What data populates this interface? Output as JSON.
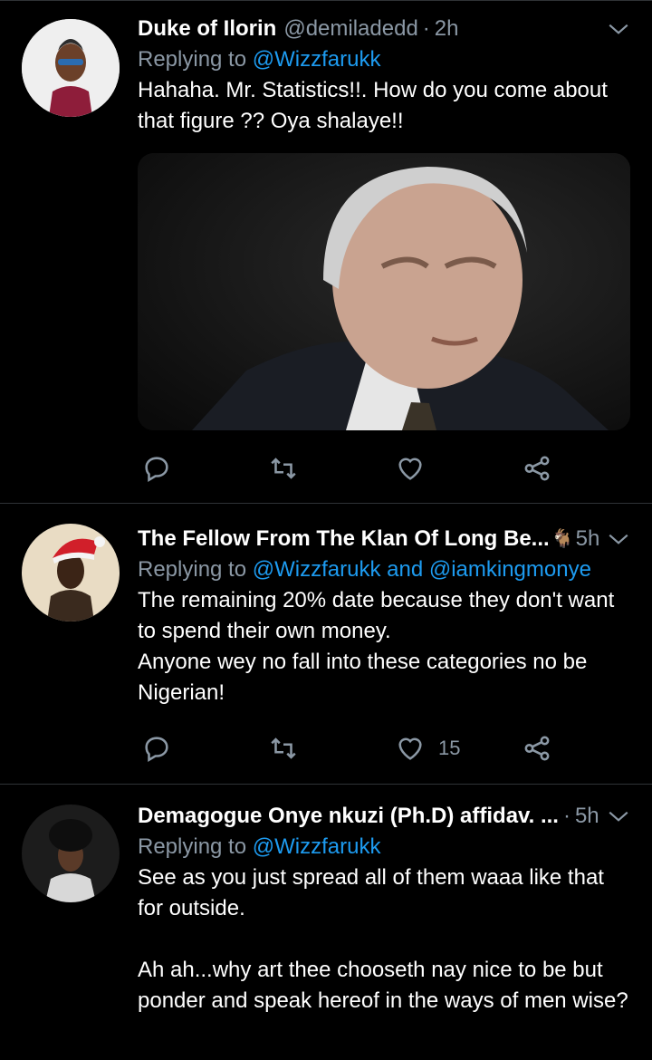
{
  "tweets": [
    {
      "name": "Duke of Ilorin",
      "handle": "@demiladedd",
      "time": "2h",
      "replying_label": "Replying to",
      "mentions": [
        "@Wizzfarukk"
      ],
      "text": "Hahaha. Mr. Statistics!!. How do you come about that figure ?? Oya shalaye!!",
      "has_media": true,
      "likes": "",
      "icons": [
        "reply-icon",
        "retweet-icon",
        "like-icon",
        "share-icon"
      ]
    },
    {
      "name": "The Fellow From The Klan Of Long Be...",
      "name_emoji": "🐐",
      "time": "5h",
      "replying_label": "Replying to",
      "mentions": [
        "@Wizzfarukk",
        "@iamkingmonye"
      ],
      "mention_joiner": "and",
      "text": "The remaining 20% date because they don't want to spend their own money.\nAnyone wey no fall into these categories no be Nigerian!",
      "likes": "15",
      "icons": [
        "reply-icon",
        "retweet-icon",
        "like-icon",
        "share-icon"
      ]
    },
    {
      "name": "Demagogue Onye nkuzi (Ph.D) affidav. ...",
      "time": "5h",
      "replying_label": "Replying to",
      "mentions": [
        "@Wizzfarukk"
      ],
      "text": "See as you just spread all of them waaa like that for outside.\n\nAh ah...why art thee chooseth nay nice to be but ponder and speak hereof in the ways of men wise?"
    }
  ],
  "colors": {
    "background": "#000000",
    "secondary_text": "#8b98a5",
    "mention": "#1d9bf0",
    "divider": "#2f3336"
  }
}
